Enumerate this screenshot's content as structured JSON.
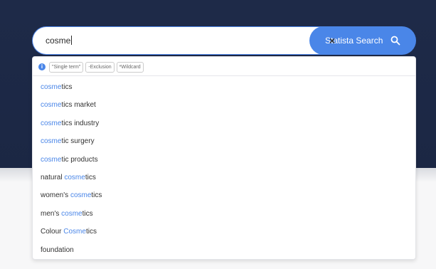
{
  "search": {
    "query": "cosme",
    "clear_symbol": "×",
    "button_label": "Statista Search"
  },
  "tips": {
    "info_symbol": "i",
    "chips": [
      "\"Single term\"",
      "-Exclusion",
      "*Wildcard"
    ]
  },
  "suggestions": [
    {
      "before": "",
      "match": "cosme",
      "after": "tics"
    },
    {
      "before": "",
      "match": "cosme",
      "after": "tics market"
    },
    {
      "before": "",
      "match": "cosme",
      "after": "tics industry"
    },
    {
      "before": "",
      "match": "cosme",
      "after": "tic surgery"
    },
    {
      "before": "",
      "match": "cosme",
      "after": "tic products"
    },
    {
      "before": "natural ",
      "match": "cosme",
      "after": "tics"
    },
    {
      "before": "women's ",
      "match": "cosme",
      "after": "tics"
    },
    {
      "before": "men's ",
      "match": "cosme",
      "after": "tics"
    },
    {
      "before": "Colour ",
      "match": "Cosme",
      "after": "tics"
    },
    {
      "before": "foundation",
      "match": "",
      "after": ""
    }
  ],
  "colors": {
    "hero": "#1e2a48",
    "accent": "#4a86e8"
  }
}
